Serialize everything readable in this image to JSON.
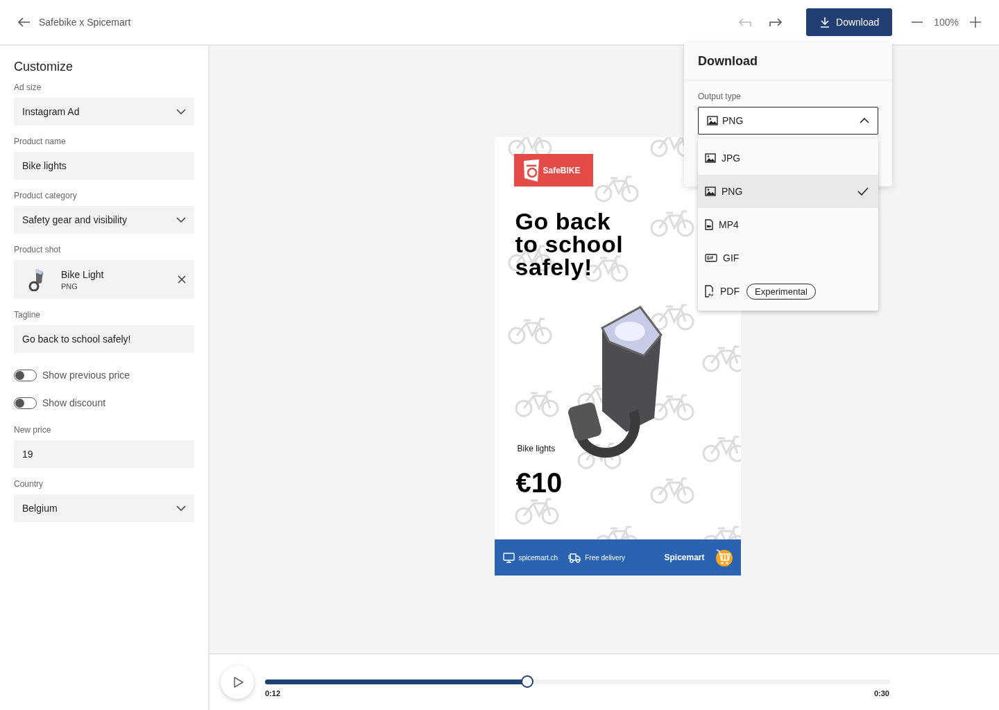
{
  "header": {
    "title": "Safebike x Spicemart",
    "undo_disabled": true,
    "redo_disabled": false,
    "download_button": "Download",
    "zoom": "100%"
  },
  "sidebar": {
    "title": "Customize",
    "fields": [
      {
        "kind": "select",
        "label": "Ad size",
        "value": "Instagram Ad"
      },
      {
        "kind": "text",
        "label": "Product name",
        "value": "Bike lights"
      },
      {
        "kind": "select",
        "label": "Product category",
        "value": "Safety gear and visibility"
      },
      {
        "kind": "file",
        "label": "Product shot",
        "name": "Bike Light",
        "type": "PNG"
      },
      {
        "kind": "text",
        "label": "Tagline",
        "value": "Go back to school safely!"
      },
      {
        "kind": "toggle",
        "label": "Show previous price",
        "on": false
      },
      {
        "kind": "toggle",
        "label": "Show discount",
        "on": false
      },
      {
        "kind": "text",
        "label": "New price",
        "value": "19"
      },
      {
        "kind": "select",
        "label": "Country",
        "value": "Belgium"
      }
    ]
  },
  "ad": {
    "brand": "SafeBIKE",
    "headline": [
      "Go back",
      "to school",
      "safely!"
    ],
    "product": "Bike lights",
    "price": "€10",
    "website": "spicemart.ch",
    "delivery": "Free delivery",
    "store": "Spicemart"
  },
  "download_panel": {
    "title": "Download",
    "output_label": "Output type",
    "value": "PNG",
    "expanded": true,
    "options": [
      {
        "kind": "image",
        "label": "JPG",
        "selected": false
      },
      {
        "kind": "image",
        "label": "PNG",
        "selected": true
      },
      {
        "kind": "video",
        "label": "MP4",
        "selected": false
      },
      {
        "kind": "gif",
        "label": "GIF",
        "selected": false
      },
      {
        "kind": "pdf",
        "label": "PDF",
        "selected": false,
        "badge": "Experimental"
      }
    ]
  },
  "timeline": {
    "level": 0.42,
    "current": "0:12",
    "total": "0:30"
  }
}
